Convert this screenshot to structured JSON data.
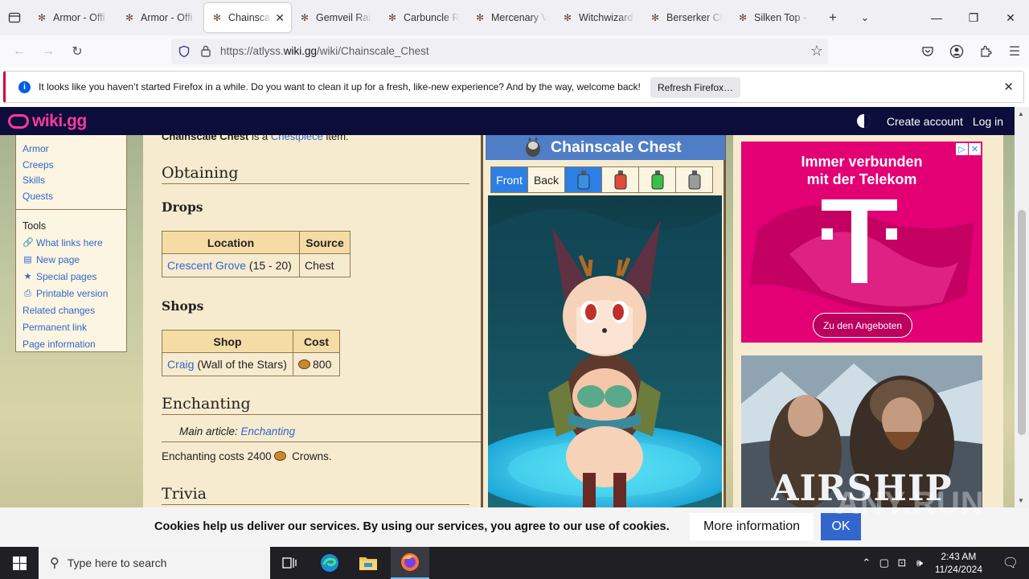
{
  "browser": {
    "tabs": [
      {
        "title": "Armor - Offi",
        "active": false
      },
      {
        "title": "Armor - Offi",
        "active": false
      },
      {
        "title": "Chainscal",
        "active": true
      },
      {
        "title": "Gemveil Rai",
        "active": false
      },
      {
        "title": "Carbuncle R",
        "active": false
      },
      {
        "title": "Mercenary V",
        "active": false
      },
      {
        "title": "Witchwizard",
        "active": false
      },
      {
        "title": "Berserker Ch",
        "active": false
      },
      {
        "title": "Silken Top -",
        "active": false
      }
    ],
    "url_prefix": "https://atlyss.",
    "url_domain": "wiki.gg",
    "url_path": "/wiki/Chainscale_Chest"
  },
  "notification": {
    "message": "It looks like you haven’t started Firefox in a while. Do you want to clean it up for a fresh, like-new experience? And by the way, welcome back!",
    "button": "Refresh Firefox…"
  },
  "site": {
    "logo": "wiki.gg",
    "create_account": "Create account",
    "log_in": "Log in"
  },
  "sidebar": {
    "nav": [
      "Armor",
      "Creeps",
      "Skills",
      "Quests"
    ],
    "tools_heading": "Tools",
    "tools": [
      {
        "label": "What links here",
        "icon": "link-icon"
      },
      {
        "label": "New page",
        "icon": "page-icon"
      },
      {
        "label": "Special pages",
        "icon": "star-icon"
      },
      {
        "label": "Printable version",
        "icon": "printer-icon"
      },
      {
        "label": "Related changes",
        "icon": ""
      },
      {
        "label": "Permanent link",
        "icon": ""
      },
      {
        "label": "Page information",
        "icon": ""
      }
    ]
  },
  "content": {
    "intro_bold": "Chainscale Chest",
    "intro_mid": " is a ",
    "intro_link": "Chestpiece",
    "intro_end": " item.",
    "obtaining": "Obtaining",
    "drops": "Drops",
    "drops_table": {
      "headers": [
        "Location",
        "Source"
      ],
      "rows": [
        {
          "link": "Crescent Grove",
          "extra": " (15 - 20)",
          "source": "Chest"
        }
      ]
    },
    "shops": "Shops",
    "shops_table": {
      "headers": [
        "Shop",
        "Cost"
      ],
      "rows": [
        {
          "link": "Craig",
          "extra": " (Wall of the Stars)",
          "cost": "800"
        }
      ]
    },
    "enchanting": "Enchanting",
    "main_article_label": "Main article: ",
    "main_article_link": "Enchanting",
    "ench_cost_pre": "Enchanting costs 2400 ",
    "ench_cost_post": " Crowns.",
    "trivia": "Trivia"
  },
  "infobox": {
    "title": "Chainscale Chest",
    "tabs": [
      "Front",
      "Back"
    ],
    "potion_colors": [
      "#3a8fe0",
      "#e04a3a",
      "#3ac04a",
      "#9a9a9a"
    ]
  },
  "ads": {
    "ad1_line1": "Immer verbunden",
    "ad1_line2": "mit der Telekom",
    "ad1_cta": "Zu den Angeboten",
    "ad1_logo": "T",
    "ad2_brand": "AIRSHIP"
  },
  "cookie": {
    "message": "Cookies help us deliver our services. By using our services, you agree to our use of cookies.",
    "more": "More information",
    "ok": "OK"
  },
  "watermark": "ANY.RUN",
  "taskbar": {
    "search_placeholder": "Type here to search",
    "time": "2:43 AM",
    "date": "11/24/2024"
  }
}
